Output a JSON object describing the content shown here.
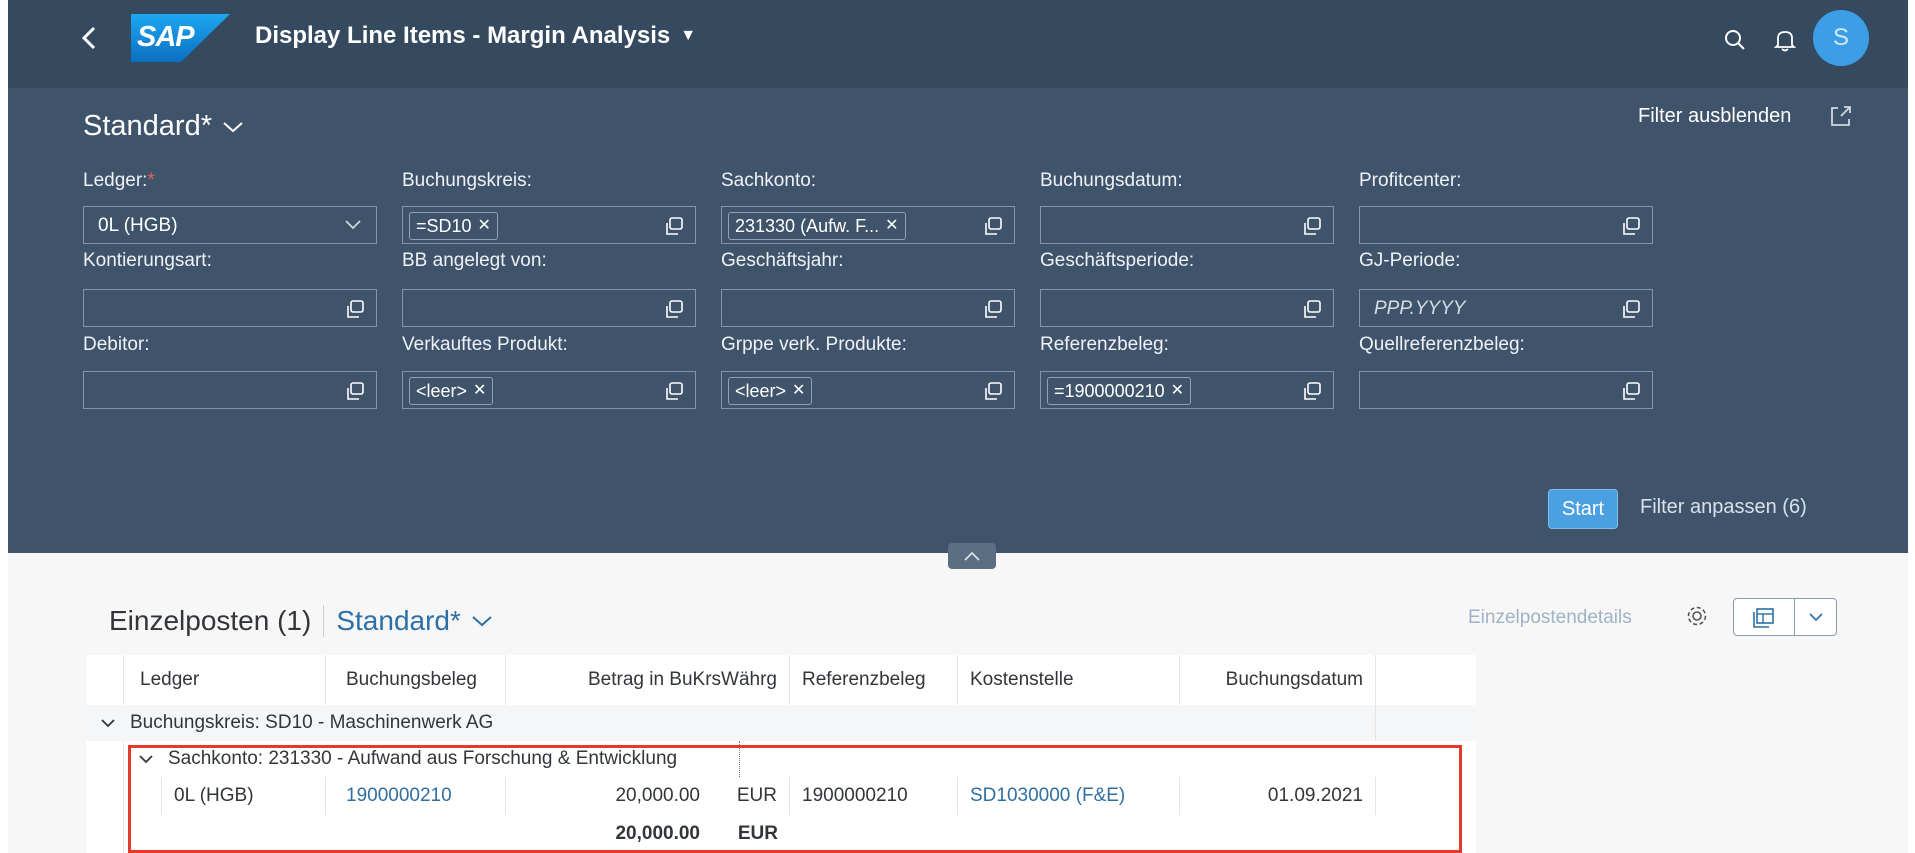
{
  "shell": {
    "title": "Display Line Items - Margin Analysis",
    "avatar_initial": "S",
    "logo_text": "SAP",
    "colors": {
      "shell_bg": "#354a5f",
      "filter_bg": "#3f536b",
      "accent": "#4aa0e0",
      "highlight": "#e43a2a"
    }
  },
  "filterbar": {
    "variant": "Standard*",
    "hide_filter": "Filter ausblenden",
    "start": "Start",
    "adapt": "Filter anpassen (6)",
    "fields": {
      "ledger": {
        "label": "Ledger:",
        "required": "*",
        "value": "0L (HGB)"
      },
      "buchungskreis": {
        "label": "Buchungskreis:",
        "token": "=SD10"
      },
      "sachkonto": {
        "label": "Sachkonto:",
        "token": "231330 (Aufw. F..."
      },
      "buchungsdatum": {
        "label": "Buchungsdatum:"
      },
      "profitcenter": {
        "label": "Profitcenter:"
      },
      "kontierungsart": {
        "label": "Kontierungsart:"
      },
      "bb_angelegt": {
        "label": "BB angelegt von:"
      },
      "geschaeftsjahr": {
        "label": "Geschäftsjahr:"
      },
      "geschaeftsperiode": {
        "label": "Geschäftsperiode:"
      },
      "gj_periode": {
        "label": "GJ-Periode:",
        "placeholder": "PPP.YYYY"
      },
      "debitor": {
        "label": "Debitor:"
      },
      "verkauftes_produkt": {
        "label": "Verkauftes Produkt:",
        "token": "<leer>"
      },
      "grppe_verk": {
        "label": "Grppe verk. Produkte:",
        "token": "<leer>"
      },
      "referenzbeleg": {
        "label": "Referenzbeleg:",
        "token": "=1900000210"
      },
      "quellreferenzbeleg": {
        "label": "Quellreferenzbeleg:"
      }
    }
  },
  "table": {
    "title": "Einzelposten (1)",
    "variant": "Standard*",
    "details": "Einzelpostendetails",
    "columns": [
      "Ledger",
      "Buchungsbeleg",
      "Betrag in BuKrsWährg",
      "Referenzbeleg",
      "Kostenstelle",
      "Buchungsdatum"
    ],
    "group1": "Buchungskreis: SD10 - Maschinenwerk AG",
    "group2": "Sachkonto: 231330 - Aufwand aus Forschung & Entwicklung",
    "row": {
      "ledger": "0L (HGB)",
      "beleg": "1900000210",
      "betrag": "20,000.00",
      "waehrung": "EUR",
      "referenz": "1900000210",
      "kostenstelle": "SD1030000 (F&E)",
      "datum": "01.09.2021"
    },
    "total": {
      "betrag": "20,000.00",
      "waehrung": "EUR"
    }
  }
}
